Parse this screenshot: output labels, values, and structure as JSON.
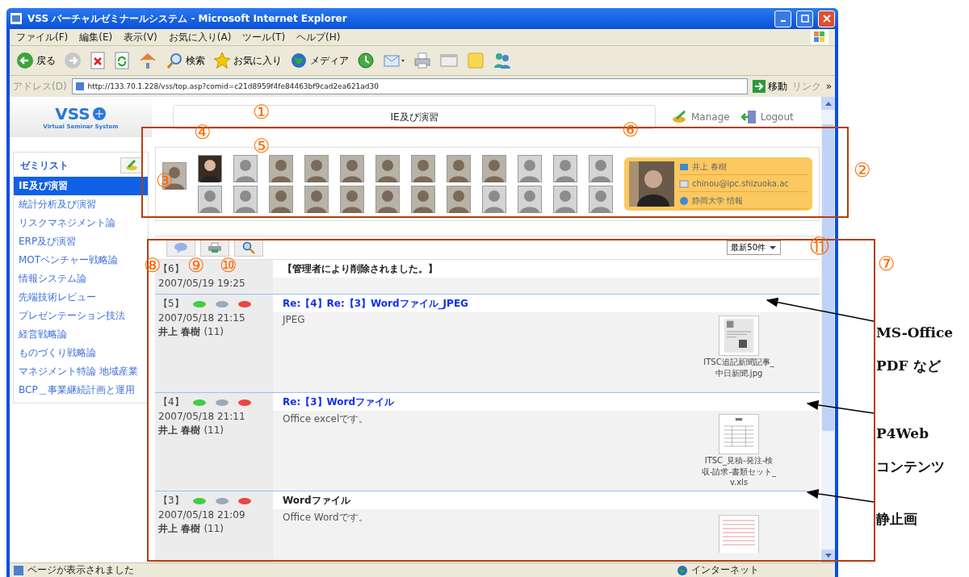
{
  "window": {
    "title": "VSS バーチャルゼミナールシステム - Microsoft Internet Explorer"
  },
  "menu": [
    "ファイル(F)",
    "編集(E)",
    "表示(V)",
    "お気に入り(A)",
    "ツール(T)",
    "ヘルプ(H)"
  ],
  "toolbar": [
    {
      "kind": "back",
      "label": "戻る"
    },
    {
      "kind": "forward"
    },
    {
      "kind": "stop"
    },
    {
      "kind": "refresh"
    },
    {
      "kind": "home"
    },
    {
      "kind": "search",
      "label": "検索"
    },
    {
      "kind": "favorites",
      "label": "お気に入り"
    },
    {
      "kind": "media",
      "label": "メディア"
    },
    {
      "kind": "history"
    },
    {
      "kind": "mail"
    },
    {
      "kind": "print"
    },
    {
      "kind": "edit"
    },
    {
      "kind": "note"
    },
    {
      "kind": "messenger"
    }
  ],
  "address": {
    "label": "アドレス(D)",
    "value": "http://133.70.1.228/vss/top.asp?comid=c21d8959f4fe84463bf9cad2ea621ad30",
    "go": "移動",
    "links": "リンク",
    "more": "»"
  },
  "logo": {
    "title": "VSS",
    "subtitle": "Virtual Seminar System"
  },
  "header": {
    "title": "IE及び演習",
    "actions": [
      "Manage",
      "Logout"
    ]
  },
  "sidebar": {
    "heading": "ゼミリスト",
    "items": [
      {
        "label": "IE及び演習",
        "selected": true
      },
      {
        "label": "統計分析及び演習",
        "selected": false
      },
      {
        "label": "リスクマネジメント論",
        "selected": false
      },
      {
        "label": "ERP及び演習",
        "selected": false
      },
      {
        "label": "MOTベンチャー戦略論",
        "selected": false
      },
      {
        "label": "情報システム論",
        "selected": false
      },
      {
        "label": "先端技術レビュー",
        "selected": false
      },
      {
        "label": "プレゼンテーション技法",
        "selected": false
      },
      {
        "label": "経営戦略論",
        "selected": false
      },
      {
        "label": "ものづくり戦略論",
        "selected": false
      },
      {
        "label": "マネジメント特論 地域産業",
        "selected": false
      },
      {
        "label": "BCP＿事業継続計画と運用",
        "selected": false
      }
    ]
  },
  "members": {
    "teacher": {
      "kind": "photo"
    },
    "rows": [
      [
        {
          "kind": "photo",
          "selected": true
        },
        {
          "kind": "blank",
          "selected": false
        },
        {
          "kind": "photo",
          "selected": false
        },
        {
          "kind": "photo",
          "selected": false
        },
        {
          "kind": "photo",
          "selected": false
        },
        {
          "kind": "photo",
          "selected": false
        },
        {
          "kind": "photo",
          "selected": false
        },
        {
          "kind": "photo",
          "selected": false
        },
        {
          "kind": "photo",
          "selected": false
        },
        {
          "kind": "blank",
          "selected": false
        },
        {
          "kind": "blank",
          "selected": false
        },
        {
          "kind": "blank",
          "selected": false
        }
      ],
      [
        {
          "kind": "blank",
          "selected": false
        },
        {
          "kind": "blank",
          "selected": false
        },
        {
          "kind": "photo",
          "selected": false
        },
        {
          "kind": "photo",
          "selected": false
        },
        {
          "kind": "photo",
          "selected": false
        },
        {
          "kind": "photo",
          "selected": false
        },
        {
          "kind": "photo",
          "selected": false
        },
        {
          "kind": "photo",
          "selected": false
        },
        {
          "kind": "blank",
          "selected": false
        },
        {
          "kind": "blank",
          "selected": false
        },
        {
          "kind": "blank",
          "selected": false
        },
        {
          "kind": "blank",
          "selected": false
        }
      ]
    ],
    "profile": {
      "name": "井上 春樹",
      "email": "chinou@ipc.shizuoka.ac",
      "affiliation": "静岡大学 情報"
    }
  },
  "posts_toolbar": {
    "buttons": [
      {
        "kind": "new"
      },
      {
        "kind": "print"
      },
      {
        "kind": "search"
      }
    ],
    "filter": "最新50件"
  },
  "posts": [
    {
      "number": "【6】",
      "date": "2007/05/19 19:25",
      "title": "【管理者により削除されました。】",
      "link": false,
      "actions": false
    },
    {
      "number": "【5】",
      "date": "2007/05/18 21:15",
      "author": "井上 春樹",
      "count": "(11)",
      "title": "Re:【4】Re:【3】Wordファイル_JPEG",
      "link": true,
      "actions": true,
      "body": "JPEG",
      "attachment": {
        "kind": "news",
        "caption": "ITSC追記新聞記事_中日新聞.jpg"
      }
    },
    {
      "number": "【4】",
      "date": "2007/05/18 21:11",
      "author": "井上 春樹",
      "count": "(11)",
      "title": "Re:【3】Wordファイル",
      "link": true,
      "actions": true,
      "body": "Office excelです。",
      "attachment": {
        "kind": "sheet",
        "caption": "ITSC_見積-発注-検収-請求-書類セット_v.xls"
      }
    },
    {
      "number": "【3】",
      "date": "2007/05/18 21:09",
      "author": "井上 春樹",
      "count": "(11)",
      "title": "Wordファイル",
      "link": false,
      "actions": true,
      "body": "Office Wordです。",
      "attachment": {
        "kind": "doc"
      }
    }
  ],
  "status_bar": {
    "text": "ページが表示されました",
    "zone": "インターネット"
  },
  "annotations": {
    "markers": [
      "①",
      "④",
      "⑥",
      "⑤",
      "③",
      "②",
      "⑪",
      "⑧",
      "⑨",
      "⑩",
      "⑦"
    ],
    "callouts": [
      "MS-Office",
      "PDF など",
      "P4Web",
      "コンテンツ",
      "静止画"
    ]
  }
}
